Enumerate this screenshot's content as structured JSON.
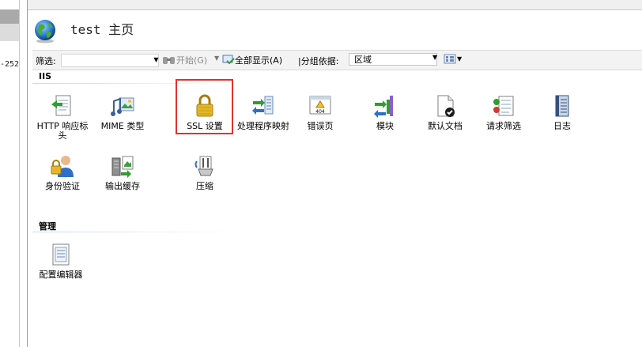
{
  "left_panel": {
    "truncated_text": "-252"
  },
  "header": {
    "title": "test 主页"
  },
  "filter_bar": {
    "filter_label": "筛选:",
    "filter_value": "",
    "start_label": "开始(G)",
    "show_all_label": "全部显示(A)",
    "group_by_label": "|分组依据:",
    "group_by_value": "区域"
  },
  "sections": {
    "iis": {
      "title": "IIS",
      "items": [
        {
          "label": "HTTP 响应标头"
        },
        {
          "label": "MIME 类型"
        },
        {
          "label": "SSL 设置"
        },
        {
          "label": "处理程序映射"
        },
        {
          "label": "错误页"
        },
        {
          "label": "模块"
        },
        {
          "label": "默认文档"
        },
        {
          "label": "请求筛选"
        },
        {
          "label": "日志"
        },
        {
          "label": "身份验证"
        },
        {
          "label": "输出缓存"
        },
        {
          "label": "压缩"
        }
      ]
    },
    "management": {
      "title": "管理",
      "items": [
        {
          "label": "配置编辑器"
        }
      ]
    }
  },
  "colors": {
    "highlight": "#e0312b"
  }
}
